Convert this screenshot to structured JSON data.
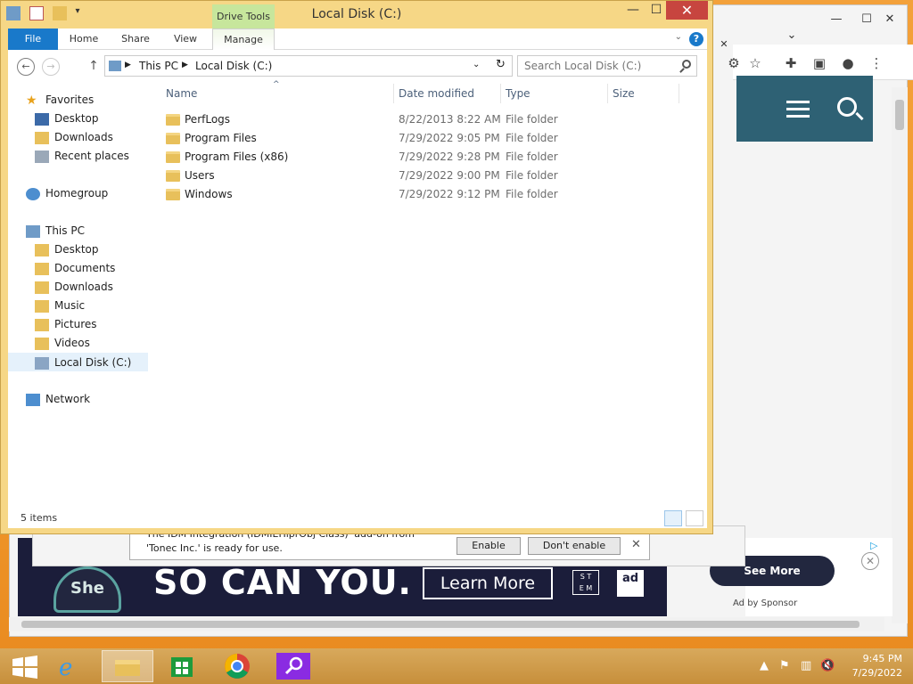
{
  "browser": {
    "window_controls": {
      "minimize": "—",
      "maximize": "☐",
      "close": "✕"
    },
    "tab_chevron": "⌄",
    "tab_close": "✕",
    "ad": {
      "headline": "SO CAN YOU.",
      "cta": "Learn More",
      "badge": "She can STEM",
      "council": "ad",
      "see_more": "See More",
      "ad_by": "Ad by Sponsor"
    }
  },
  "infobar": {
    "message_line1": "The IDM Integration (IDMIEHlprObj Class)' add-on from",
    "message_line2": "'Tonec Inc.' is ready for use.",
    "enable": "Enable",
    "dont_enable": "Don't enable",
    "close": "✕"
  },
  "explorer": {
    "title": "Local Disk (C:)",
    "context_tab": "Drive Tools",
    "ribbon_tabs": [
      "File",
      "Home",
      "Share",
      "View",
      "Manage"
    ],
    "address": {
      "root": "This PC",
      "current": "Local Disk (C:)"
    },
    "search_placeholder": "Search Local Disk (C:)",
    "columns": [
      "Name",
      "Date modified",
      "Type",
      "Size"
    ],
    "files": [
      {
        "name": "PerfLogs",
        "date": "8/22/2013 8:22 AM",
        "type": "File folder",
        "size": ""
      },
      {
        "name": "Program Files",
        "date": "7/29/2022 9:05 PM",
        "type": "File folder",
        "size": ""
      },
      {
        "name": "Program Files (x86)",
        "date": "7/29/2022 9:28 PM",
        "type": "File folder",
        "size": ""
      },
      {
        "name": "Users",
        "date": "7/29/2022 9:00 PM",
        "type": "File folder",
        "size": ""
      },
      {
        "name": "Windows",
        "date": "7/29/2022 9:12 PM",
        "type": "File folder",
        "size": ""
      }
    ],
    "nav": {
      "favorites": "Favorites",
      "fav_items": [
        "Desktop",
        "Downloads",
        "Recent places"
      ],
      "homegroup": "Homegroup",
      "thispc": "This PC",
      "pc_items": [
        "Desktop",
        "Documents",
        "Downloads",
        "Music",
        "Pictures",
        "Videos",
        "Local Disk (C:)"
      ],
      "network": "Network"
    },
    "status": "5 items",
    "colors": {
      "accent": "#1979ca",
      "frame": "#f6d786",
      "folder": "#e8c05b"
    }
  },
  "taskbar": {
    "time": "9:45 PM",
    "date": "7/29/2022",
    "apps": [
      "start-icon",
      "ie-icon",
      "file-explorer-icon",
      "store-icon",
      "chrome-icon",
      "search-app-icon"
    ]
  }
}
